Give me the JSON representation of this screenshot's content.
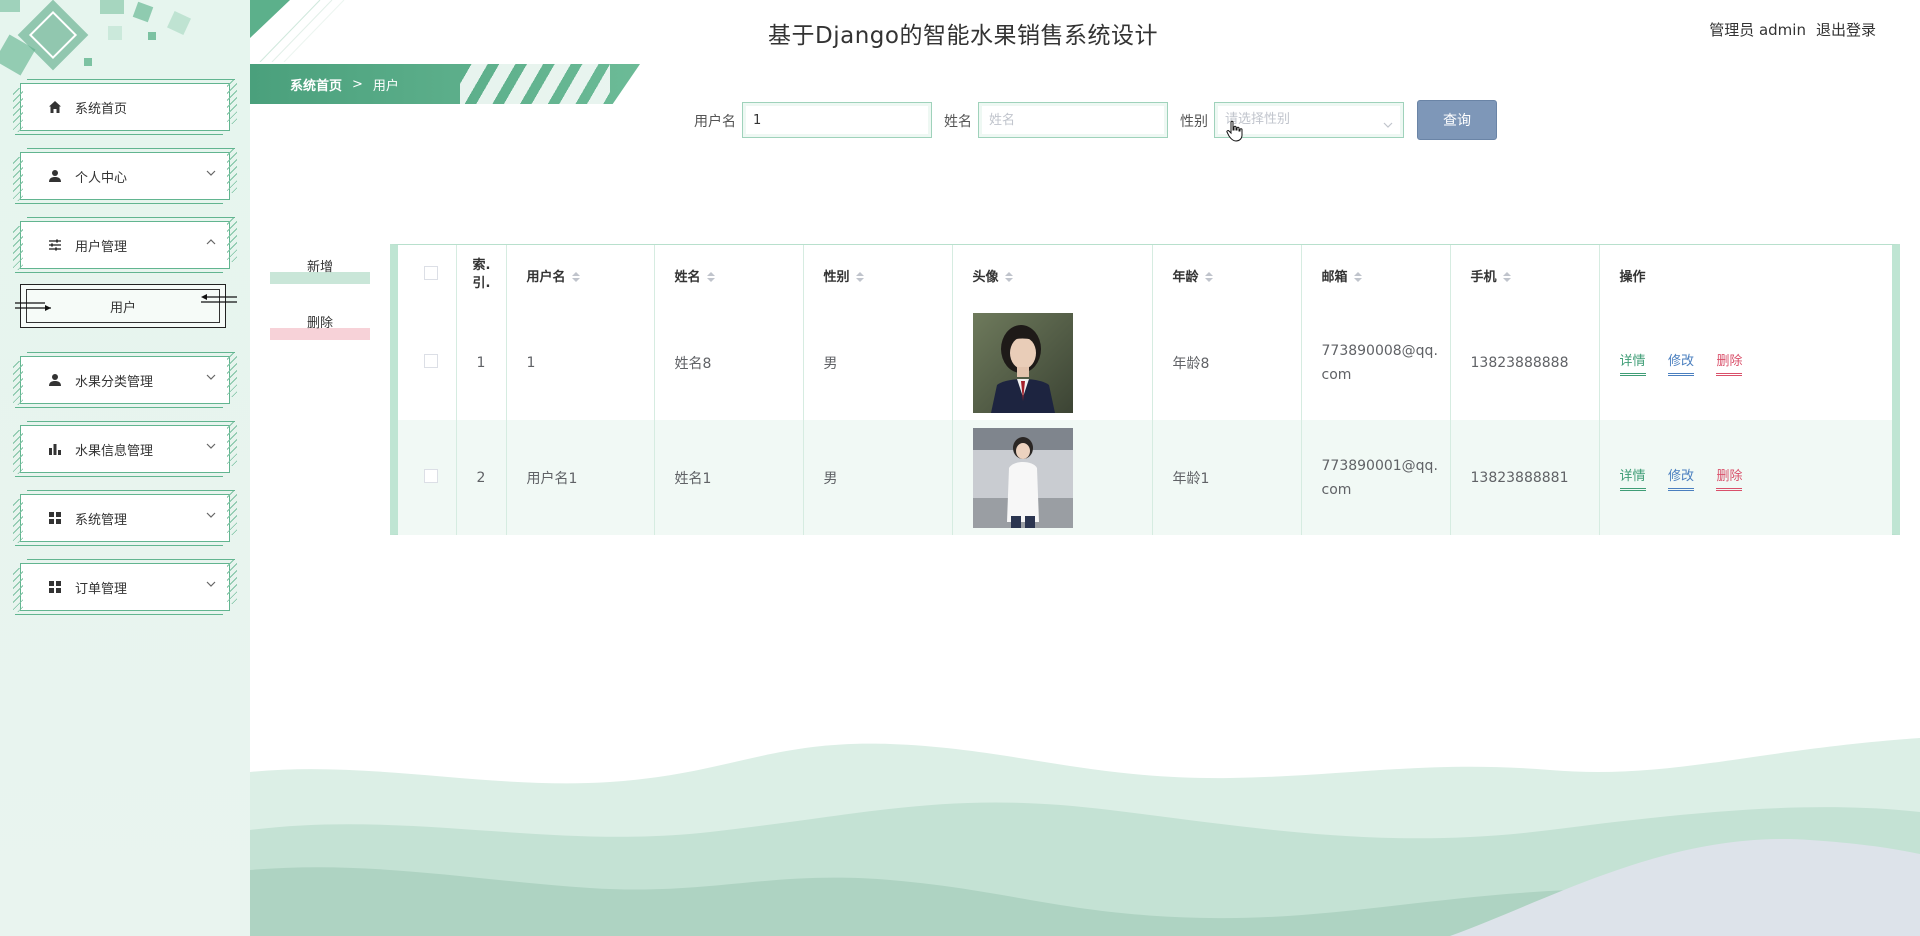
{
  "app": {
    "title": "基于Django的智能水果销售系统设计",
    "user_role": "管理员 admin",
    "logout_label": "退出登录"
  },
  "sidebar": {
    "items": [
      {
        "label": "系统首页",
        "icon": "home-icon",
        "expanded": null
      },
      {
        "label": "个人中心",
        "icon": "person-icon",
        "expanded": false
      },
      {
        "label": "用户管理",
        "icon": "sliders-icon",
        "expanded": true
      },
      {
        "label": "水果分类管理",
        "icon": "person-icon",
        "expanded": false
      },
      {
        "label": "水果信息管理",
        "icon": "bar-chart-icon",
        "expanded": false
      },
      {
        "label": "系统管理",
        "icon": "grid-icon",
        "expanded": false
      },
      {
        "label": "订单管理",
        "icon": "grid-icon",
        "expanded": false
      }
    ],
    "submenu": {
      "label": "用户"
    }
  },
  "breadcrumb": {
    "home": "系统首页",
    "separator": ">",
    "current": "用户"
  },
  "search": {
    "username_label": "用户名",
    "username_value": "1",
    "name_label": "姓名",
    "name_placeholder": "姓名",
    "gender_label": "性别",
    "gender_placeholder": "请选择性别",
    "button_label": "查询"
  },
  "actions": {
    "add_label": "新增",
    "delete_label": "删除"
  },
  "table": {
    "columns": [
      "索引",
      "用户名",
      "姓名",
      "性别",
      "头像",
      "年龄",
      "邮箱",
      "手机",
      "操作"
    ],
    "index_header": "索.\n引.",
    "rows": [
      {
        "index": "1",
        "username": "1",
        "name": "姓名8",
        "gender": "男",
        "age": "年龄8",
        "email": "773890008@qq.com",
        "phone": "13823888888"
      },
      {
        "index": "2",
        "username": "用户名1",
        "name": "姓名1",
        "gender": "男",
        "age": "年龄1",
        "email": "773890001@qq.com",
        "phone": "13823888881"
      }
    ],
    "op_detail": "详情",
    "op_edit": "修改",
    "op_delete": "删除"
  },
  "colors": {
    "accent": "#4aa07c",
    "search_button": "#7e97b8",
    "delete": "#d9506a",
    "edit": "#4a7fbf"
  }
}
